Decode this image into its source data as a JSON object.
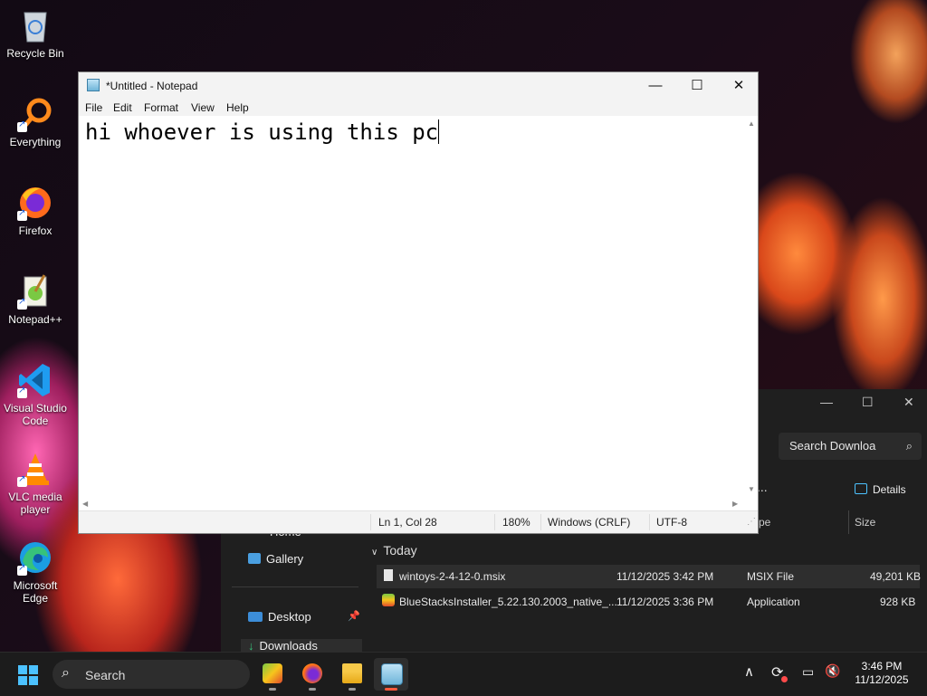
{
  "desktop": {
    "icons": [
      {
        "label": "Recycle Bin",
        "icon": "recycle-bin-icon"
      },
      {
        "label": "Everything",
        "icon": "magnifier-icon"
      },
      {
        "label": "Firefox",
        "icon": "firefox-icon"
      },
      {
        "label": "Notepad++",
        "icon": "notepadpp-icon"
      },
      {
        "label": "Visual Studio Code",
        "icon": "vscode-icon"
      },
      {
        "label": "VLC media player",
        "icon": "vlc-icon"
      },
      {
        "label": "Microsoft Edge",
        "icon": "edge-icon"
      }
    ]
  },
  "notepad": {
    "title": "*Untitled - Notepad",
    "menu": [
      "File",
      "Edit",
      "Format",
      "View",
      "Help"
    ],
    "content": "hi whoever is using this pc",
    "status": {
      "position": "Ln 1, Col 28",
      "zoom": "180%",
      "line_ending": "Windows (CRLF)",
      "encoding": "UTF-8"
    },
    "controls": {
      "minimize": "—",
      "maximize": "☐",
      "close": "✕"
    }
  },
  "explorer": {
    "search_placeholder": "Search Downloa",
    "details_label": "Details",
    "more_label": "...",
    "column_type": "pe",
    "column_size": "Size",
    "group": "Today",
    "sidebar": {
      "home": "Home",
      "gallery": "Gallery",
      "desktop": "Desktop",
      "downloads": "Downloads"
    },
    "files": [
      {
        "name": "wintoys-2-4-12-0.msix",
        "date": "11/12/2025 3:42 PM",
        "type": "MSIX File",
        "size": "49,201 KB"
      },
      {
        "name": "BlueStacksInstaller_5.22.130.2003_native_...",
        "date": "11/12/2025 3:36 PM",
        "type": "Application",
        "size": "928 KB"
      }
    ]
  },
  "taskbar": {
    "search_label": "Search",
    "apps": [
      "bluestacks-icon",
      "firefox-icon",
      "file-explorer-icon",
      "notepad-icon"
    ],
    "time": "3:46 PM",
    "date": "11/12/2025"
  },
  "colors": {
    "accent": "#4cc2ff",
    "notepad_bg": "#ffffff",
    "taskbar_bg": "#1c1c1c"
  }
}
